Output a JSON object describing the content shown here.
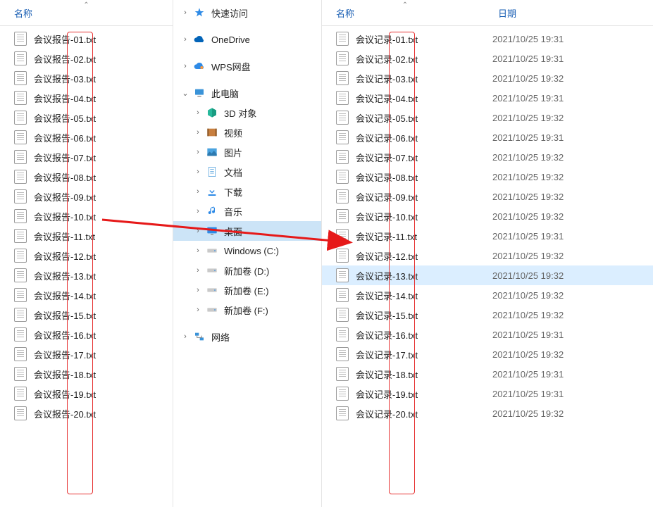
{
  "headers": {
    "name": "名称",
    "date": "日期"
  },
  "left_files": [
    {
      "name": "会议报告-01.txt"
    },
    {
      "name": "会议报告-02.txt"
    },
    {
      "name": "会议报告-03.txt"
    },
    {
      "name": "会议报告-04.txt"
    },
    {
      "name": "会议报告-05.txt"
    },
    {
      "name": "会议报告-06.txt"
    },
    {
      "name": "会议报告-07.txt"
    },
    {
      "name": "会议报告-08.txt"
    },
    {
      "name": "会议报告-09.txt"
    },
    {
      "name": "会议报告-10.txt"
    },
    {
      "name": "会议报告-11.txt"
    },
    {
      "name": "会议报告-12.txt"
    },
    {
      "name": "会议报告-13.txt"
    },
    {
      "name": "会议报告-14.txt"
    },
    {
      "name": "会议报告-15.txt"
    },
    {
      "name": "会议报告-16.txt"
    },
    {
      "name": "会议报告-17.txt"
    },
    {
      "name": "会议报告-18.txt"
    },
    {
      "name": "会议报告-19.txt"
    },
    {
      "name": "会议报告-20.txt"
    }
  ],
  "nav": [
    {
      "label": "快速访问",
      "icon": "star",
      "chev": ">"
    },
    {
      "label": "OneDrive",
      "icon": "cloud",
      "chev": ">"
    },
    {
      "label": "WPS网盘",
      "icon": "wps",
      "chev": ">"
    },
    {
      "label": "此电脑",
      "icon": "pc",
      "chev": "v",
      "sub": false
    },
    {
      "label": "3D 对象",
      "icon": "cube",
      "chev": ">",
      "sub": true
    },
    {
      "label": "视频",
      "icon": "video",
      "chev": ">",
      "sub": true
    },
    {
      "label": "图片",
      "icon": "image",
      "chev": ">",
      "sub": true
    },
    {
      "label": "文档",
      "icon": "doc",
      "chev": ">",
      "sub": true
    },
    {
      "label": "下载",
      "icon": "download",
      "chev": ">",
      "sub": true
    },
    {
      "label": "音乐",
      "icon": "music",
      "chev": ">",
      "sub": true
    },
    {
      "label": "桌面",
      "icon": "desktop",
      "chev": ">",
      "sub": true,
      "selected": true
    },
    {
      "label": "Windows (C:)",
      "icon": "drive",
      "chev": ">",
      "sub": true
    },
    {
      "label": "新加卷 (D:)",
      "icon": "drive",
      "chev": ">",
      "sub": true
    },
    {
      "label": "新加卷 (E:)",
      "icon": "drive",
      "chev": ">",
      "sub": true
    },
    {
      "label": "新加卷 (F:)",
      "icon": "drive",
      "chev": ">",
      "sub": true
    },
    {
      "label": "网络",
      "icon": "network",
      "chev": ">"
    }
  ],
  "right_files": [
    {
      "name": "会议记录-01.txt",
      "date": "2021/10/25 19:31"
    },
    {
      "name": "会议记录-02.txt",
      "date": "2021/10/25 19:31"
    },
    {
      "name": "会议记录-03.txt",
      "date": "2021/10/25 19:32"
    },
    {
      "name": "会议记录-04.txt",
      "date": "2021/10/25 19:31"
    },
    {
      "name": "会议记录-05.txt",
      "date": "2021/10/25 19:32"
    },
    {
      "name": "会议记录-06.txt",
      "date": "2021/10/25 19:31"
    },
    {
      "name": "会议记录-07.txt",
      "date": "2021/10/25 19:32"
    },
    {
      "name": "会议记录-08.txt",
      "date": "2021/10/25 19:32"
    },
    {
      "name": "会议记录-09.txt",
      "date": "2021/10/25 19:32"
    },
    {
      "name": "会议记录-10.txt",
      "date": "2021/10/25 19:32"
    },
    {
      "name": "会议记录-11.txt",
      "date": "2021/10/25 19:31"
    },
    {
      "name": "会议记录-12.txt",
      "date": "2021/10/25 19:32"
    },
    {
      "name": "会议记录-13.txt",
      "date": "2021/10/25 19:32",
      "selected": true
    },
    {
      "name": "会议记录-14.txt",
      "date": "2021/10/25 19:32"
    },
    {
      "name": "会议记录-15.txt",
      "date": "2021/10/25 19:32"
    },
    {
      "name": "会议记录-16.txt",
      "date": "2021/10/25 19:31"
    },
    {
      "name": "会议记录-17.txt",
      "date": "2021/10/25 19:32"
    },
    {
      "name": "会议记录-18.txt",
      "date": "2021/10/25 19:31"
    },
    {
      "name": "会议记录-19.txt",
      "date": "2021/10/25 19:31"
    },
    {
      "name": "会议记录-20.txt",
      "date": "2021/10/25 19:32"
    }
  ]
}
